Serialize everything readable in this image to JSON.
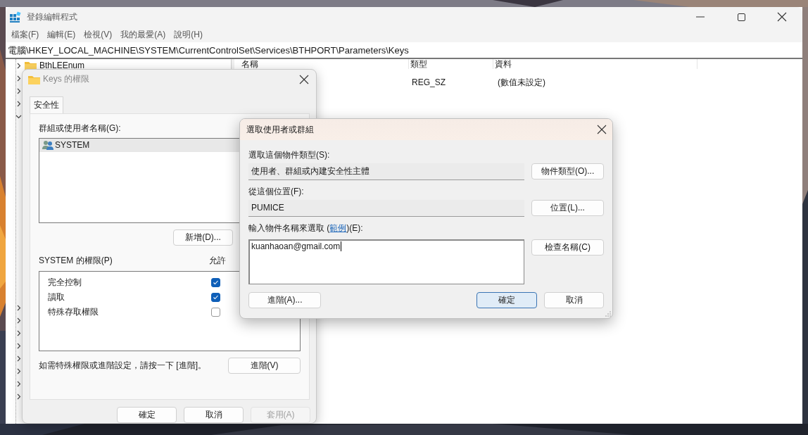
{
  "window": {
    "title": "登錄編輯程式",
    "menu": [
      "檔案(F)",
      "編輯(E)",
      "檢視(V)",
      "我的最愛(A)",
      "說明(H)"
    ],
    "address": "電腦\\HKEY_LOCAL_MACHINE\\SYSTEM\\CurrentControlSet\\Services\\BTHPORT\\Parameters\\Keys",
    "tree": [
      {
        "label": "BthLEEnum",
        "expanded": false
      },
      {
        "expanded": false
      },
      {
        "expanded": false
      },
      {
        "expanded": false
      },
      {
        "expanded": true
      },
      {
        "expanded": false
      },
      {
        "expanded": false
      },
      {
        "expanded": false
      },
      {
        "expanded": false
      },
      {
        "expanded": false
      },
      {
        "expanded": false
      },
      {
        "expanded": false
      },
      {
        "expanded": false
      }
    ],
    "list": {
      "columns": [
        "名稱",
        "類型",
        "資料"
      ],
      "rows": [
        {
          "type": "REG_SZ",
          "data": "(數值未設定)"
        }
      ]
    }
  },
  "permissions_dialog": {
    "title": "Keys 的權限",
    "tabs": [
      {
        "label": "安全性",
        "selected": true
      }
    ],
    "groups_label": "群組或使用者名稱(G):",
    "groups": [
      {
        "name": "SYSTEM",
        "selected": true
      }
    ],
    "add_button": "新增(D)...",
    "permissions_label": "SYSTEM 的權限(P)",
    "allow_header": "允許",
    "permissions": [
      {
        "name": "完全控制",
        "checked": true
      },
      {
        "name": "讀取",
        "checked": true
      },
      {
        "name": "特殊存取權限",
        "checked": false
      }
    ],
    "hint": "如需特殊權限或進階設定，請按一下 [進階]。",
    "advanced_button": "進階(V)",
    "buttons": [
      {
        "label": "確定",
        "disabled": false
      },
      {
        "label": "取消",
        "disabled": false
      },
      {
        "label": "套用(A)",
        "disabled": true
      }
    ]
  },
  "select_dialog": {
    "title": "選取使用者或群組",
    "object_type_label": "選取這個物件類型(S):",
    "object_type": "使用者、群組或內建安全性主體",
    "object_types_button": "物件類型(O)...",
    "location_label": "從這個位置(F):",
    "location": "PUMICE",
    "locations_button": "位置(L)...",
    "names_label": {
      "before": "輸入物件名稱來選取 (",
      "link": "範例",
      "after": ")(E):"
    },
    "names_value": "kuanhaoan@gmail.com",
    "check_names_button": "檢查名稱(C)",
    "advanced_button": "進階(A)...",
    "buttons": [
      {
        "label": "確定",
        "default": true
      },
      {
        "label": "取消",
        "default": false
      }
    ]
  }
}
